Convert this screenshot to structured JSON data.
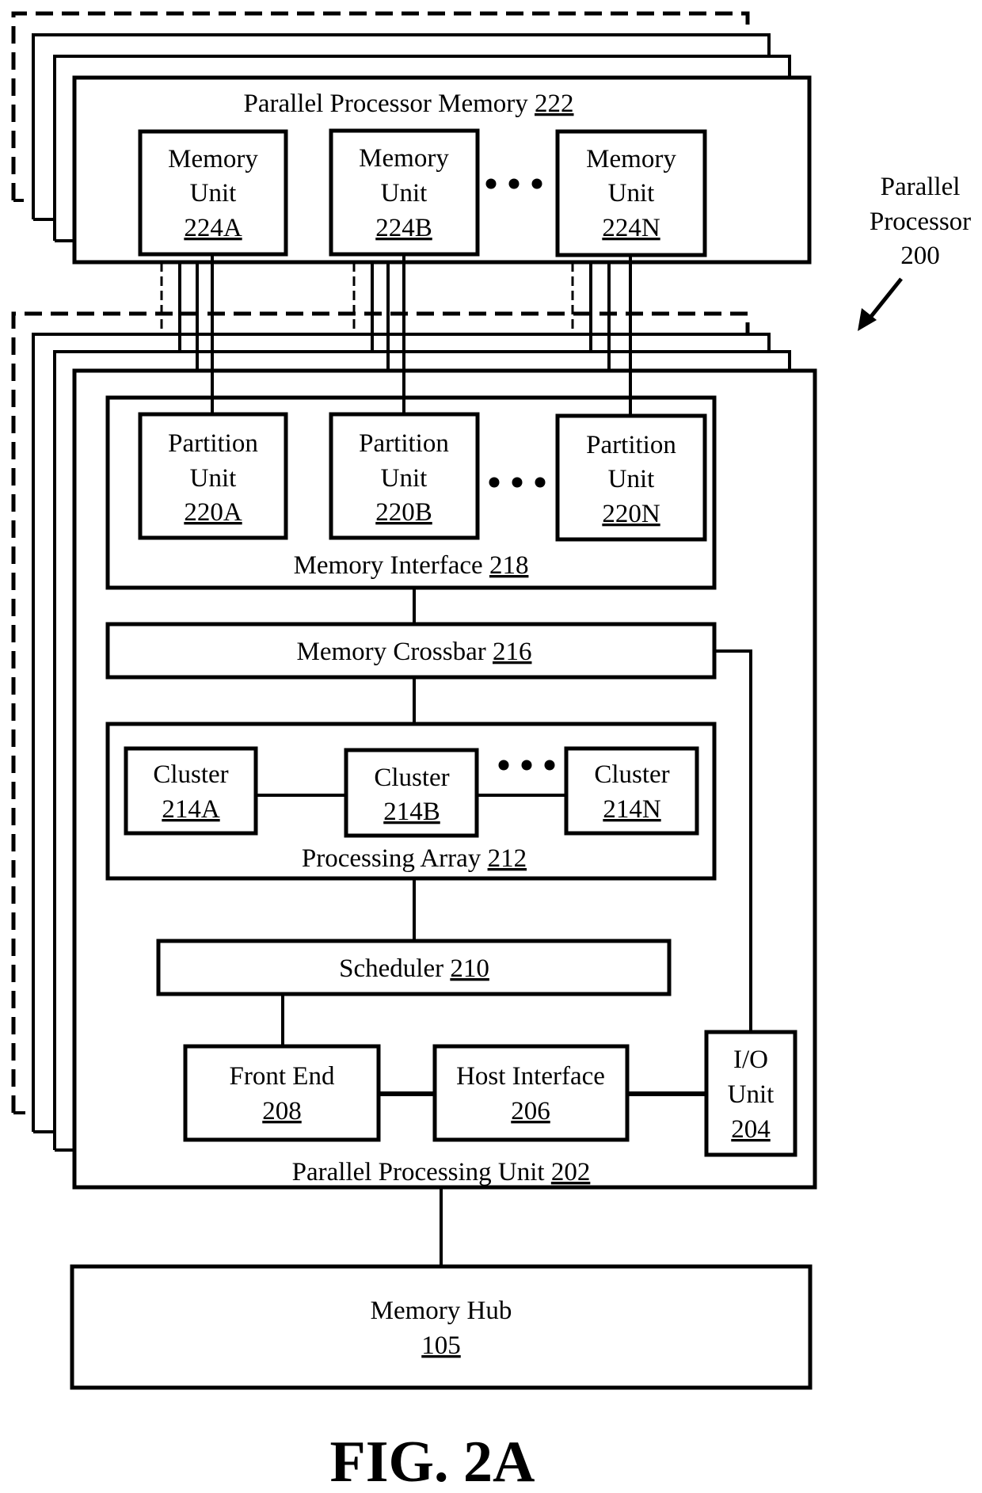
{
  "figure": {
    "caption": "FIG. 2A",
    "callout": {
      "lines": [
        "Parallel",
        "Processor",
        "200"
      ],
      "arrow": "arrow-pointing-to-stack"
    }
  },
  "memory": {
    "title": "Parallel Processor Memory",
    "ref": "222",
    "units": [
      {
        "line1": "Memory",
        "line2": "Unit",
        "ref": "224A"
      },
      {
        "line1": "Memory",
        "line2": "Unit",
        "ref": "224B"
      },
      {
        "line1": "Memory",
        "line2": "Unit",
        "ref": "224N"
      }
    ],
    "ellipsis": "..."
  },
  "ppu": {
    "title": "Parallel Processing Unit",
    "ref": "202",
    "memory_interface": {
      "title": "Memory Interface",
      "ref": "218",
      "partitions": [
        {
          "line1": "Partition",
          "line2": "Unit",
          "ref": "220A"
        },
        {
          "line1": "Partition",
          "line2": "Unit",
          "ref": "220B"
        },
        {
          "line1": "Partition",
          "line2": "Unit",
          "ref": "220N"
        }
      ]
    },
    "crossbar": {
      "title": "Memory Crossbar",
      "ref": "216"
    },
    "processing_array": {
      "title": "Processing Array",
      "ref": "212",
      "clusters": [
        {
          "label": "Cluster",
          "ref": "214A"
        },
        {
          "label": "Cluster",
          "ref": "214B"
        },
        {
          "label": "Cluster",
          "ref": "214N"
        }
      ]
    },
    "scheduler": {
      "title": "Scheduler",
      "ref": "210"
    },
    "front_end": {
      "title": "Front End",
      "ref": "208"
    },
    "host_interface": {
      "title": "Host Interface",
      "ref": "206"
    },
    "io_unit": {
      "line1": "I/O",
      "line2": "Unit",
      "ref": "204"
    }
  },
  "memory_hub": {
    "title": "Memory Hub",
    "ref": "105"
  }
}
